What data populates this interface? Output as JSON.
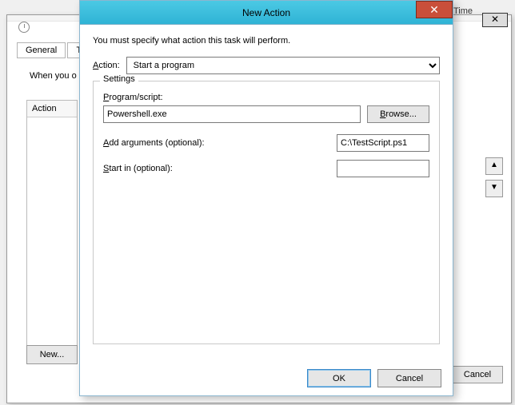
{
  "bg": {
    "run_time_header": "un Time",
    "tabs": {
      "general": "General",
      "triggers": "Trig"
    },
    "when_text": "When you o",
    "action_col_header": "Action",
    "new_btn": "New...",
    "cancel_btn": "Cancel"
  },
  "dialog": {
    "title": "New Action",
    "intro": "You must specify what action this task will perform.",
    "action_label": "Action:",
    "action_selected": "Start a program",
    "settings_legend": "Settings",
    "program_label_pre": "P",
    "program_label_post": "rogram/script:",
    "program_value": "Powershell.exe",
    "browse_label_pre": "B",
    "browse_label_post": "rowse...",
    "args_label_pre": "A",
    "args_label_post": "dd arguments (optional):",
    "args_value": "C:\\TestScript.ps1",
    "startin_label_pre": "S",
    "startin_label_post": "tart in (optional):",
    "startin_value": "",
    "ok": "OK",
    "cancel": "Cancel"
  }
}
